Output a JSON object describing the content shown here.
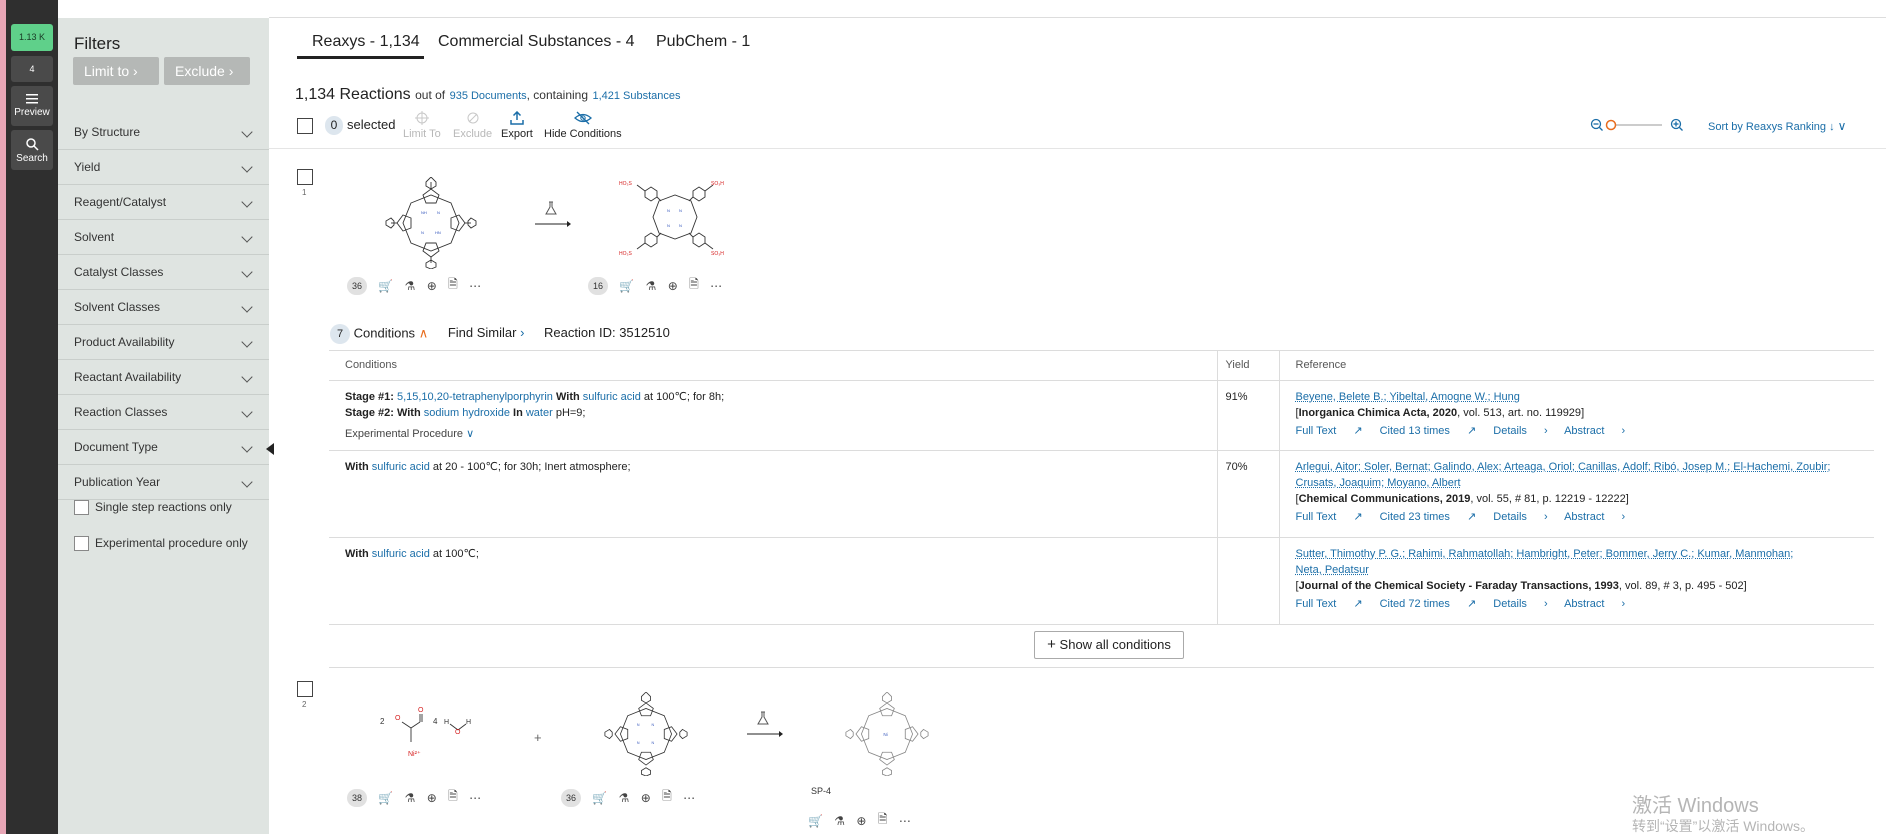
{
  "rail": {
    "count_badge": "1.13 K",
    "sub_badge": "4",
    "preview_label": "Preview",
    "search_label": "Search",
    "accent": "#5fd08a"
  },
  "filters": {
    "title": "Filters",
    "limit_label": "Limit to",
    "exclude_label": "Exclude",
    "items": [
      "By Structure",
      "Yield",
      "Reagent/Catalyst",
      "Solvent",
      "Catalyst Classes",
      "Solvent Classes",
      "Product Availability",
      "Reactant Availability",
      "Reaction Classes",
      "Document Type",
      "Publication Year"
    ],
    "checks": [
      "Single step reactions only",
      "Experimental procedure only"
    ]
  },
  "tabs": [
    "Reaxys - 1,134",
    "Commercial Substances - 4",
    "PubChem - 1"
  ],
  "header": {
    "reactions": "1,134 Reactions",
    "out_of": "out of",
    "documents": "935 Documents",
    "containing": ", containing",
    "substances": "1,421 Substances"
  },
  "toolbar": {
    "selected_count": "0",
    "selected_label": "selected",
    "limit_to": "Limit To",
    "exclude": "Exclude",
    "export": "Export",
    "hide_conditions": "Hide Conditions",
    "sort": "Sort by Reaxys Ranking"
  },
  "reaction1": {
    "number": "1",
    "reactant_count": "36",
    "product_count": "16",
    "conditions_count": "7",
    "conditions_label": "Conditions",
    "find_similar": "Find Similar",
    "reaction_id": "Reaction ID: 3512510",
    "table_headers": [
      "Conditions",
      "Yield",
      "Reference"
    ],
    "rows": [
      {
        "cond_lines": [
          {
            "prefix": "Stage #1: ",
            "reagent": "5,15,10,20-tetraphenylporphyrin",
            "mid": " With ",
            "reagent2": "sulfuric acid",
            "suffix": " at 100℃; for 8h;"
          },
          {
            "prefix": "Stage #2: With ",
            "reagent": "sodium hydroxide",
            "mid": " In ",
            "reagent2": "water",
            "suffix": " pH=9;"
          }
        ],
        "exp_proc": "Experimental Procedure",
        "yield": "91%",
        "authors": "Beyene, Belete B.; Yibeltal, Amogne W.; Hung",
        "journal_bold": "Inorganica Chimica Acta, 2020",
        "journal_rest": ", vol. 513, art. no. 119929",
        "cited": "Cited 13 times"
      },
      {
        "cond_lines": [
          {
            "prefix": "With ",
            "reagent": "sulfuric acid",
            "mid": "",
            "reagent2": "",
            "suffix": " at 20 - 100℃; for 30h; Inert atmosphere;"
          }
        ],
        "yield": "70%",
        "authors": "Arlegui, Aitor; Soler, Bernat; Galindo, Alex; Arteaga, Oriol; Canillas, Adolf; Ribó, Josep M.; El-Hachemi, Zoubir;",
        "authors2": "Crusats, Joaquim; Moyano, Albert",
        "journal_bold": "Chemical Communications, 2019",
        "journal_rest": ", vol. 55, # 81, p. 12219 - 12222",
        "cited": "Cited 23 times"
      },
      {
        "cond_lines": [
          {
            "prefix": "With ",
            "reagent": "sulfuric acid",
            "mid": "",
            "reagent2": "",
            "suffix": " at 100℃;"
          }
        ],
        "yield": "",
        "authors": "Sutter, Thimothy P. G.; Rahimi, Rahmatollah; Hambright, Peter; Bommer, Jerry C.; Kumar, Manmohan;",
        "authors2": "Neta, Pedatsur",
        "journal_bold": "Journal of the Chemical Society - Faraday Transactions, 1993",
        "journal_rest": ", vol. 89, # 3, p. 495 - 502",
        "cited": "Cited 72 times"
      }
    ],
    "full_text": "Full Text",
    "details": "Details",
    "abstract": "Abstract",
    "show_all": "Show all conditions"
  },
  "reaction2": {
    "number": "2",
    "count_a": "38",
    "count_b": "36",
    "label_2": "2",
    "label_4": "4",
    "plus": "+",
    "product_label": "SP-4"
  },
  "watermark": {
    "line1": "激活 Windows",
    "line2": "转到“设置”以激活 Windows。"
  }
}
